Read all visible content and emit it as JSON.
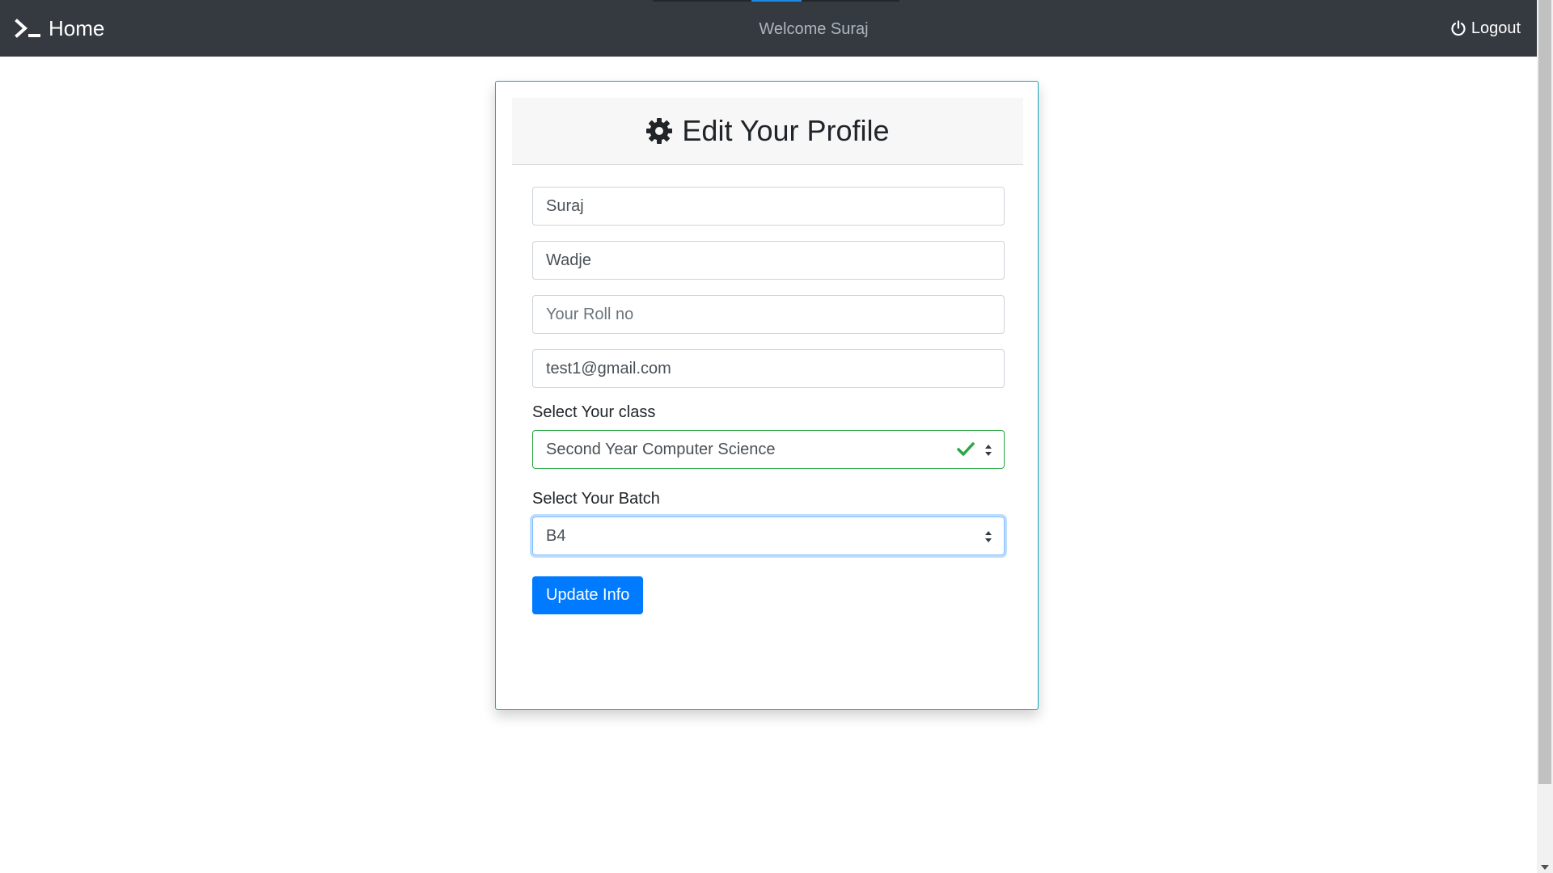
{
  "navbar": {
    "brand_label": "Home",
    "welcome_text": "Welcome Suraj",
    "logout_label": "Logout"
  },
  "card": {
    "title": "Edit Your Profile"
  },
  "form": {
    "first_name": {
      "value": "Suraj",
      "placeholder": ""
    },
    "last_name": {
      "value": "Wadje",
      "placeholder": ""
    },
    "roll_no": {
      "value": "",
      "placeholder": "Your Roll no"
    },
    "email": {
      "value": "test1@gmail.com",
      "placeholder": ""
    },
    "class_label": "Select Your class",
    "class_selected": "Second Year Computer Science",
    "batch_label": "Select Your Batch",
    "batch_selected": "B4",
    "submit_label": "Update Info"
  },
  "icons": {
    "brand": "terminal-icon",
    "logout": "power-icon",
    "title": "gear-icon",
    "valid": "check-icon",
    "select": "updown-arrow-icon"
  },
  "colors": {
    "navbar_bg": "#343a40",
    "primary": "#007bff",
    "valid": "#28a745",
    "card_border": "#17a2b8"
  }
}
